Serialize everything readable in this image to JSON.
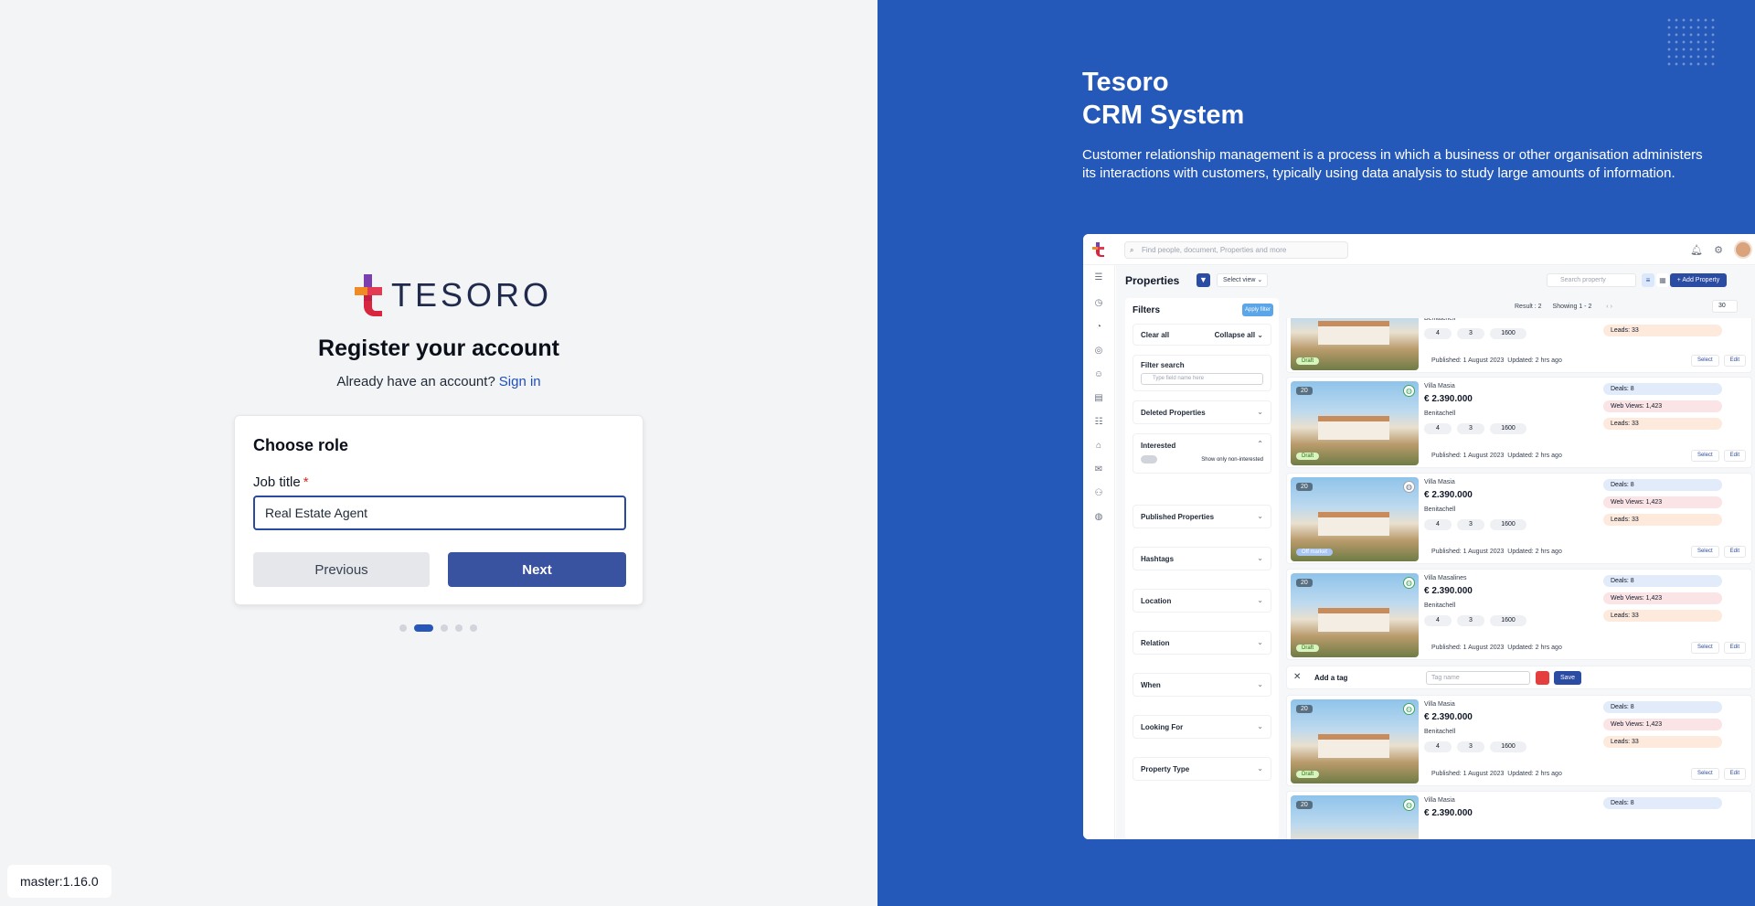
{
  "brand": {
    "name": "TESORO"
  },
  "register": {
    "title": "Register your account",
    "have_account": "Already have an account?",
    "sign_in": "Sign in"
  },
  "card": {
    "title": "Choose role",
    "job_title_label": "Job title",
    "required_mark": "*",
    "job_title_value": "Real Estate Agent",
    "previous_label": "Previous",
    "next_label": "Next"
  },
  "stepper": {
    "total": 5,
    "current": 2
  },
  "version": "master:1.16.0",
  "promo": {
    "title_line1": "Tesoro",
    "title_line2": "CRM System",
    "description": "Customer relationship management is a process in which a business or other organisation administers its interactions with customers, typically using data analysis to study large amounts of information."
  },
  "colors": {
    "primary": "#2559b9",
    "button": "#3a53a0",
    "link": "#1d4fbf"
  },
  "mock": {
    "search_placeholder": "Find people, document, Properties and more",
    "page_title": "Properties",
    "select_view": "Select view ⌄",
    "search_property": "Search property",
    "add_property": "+ Add Property",
    "filters_title": "Filters",
    "apply_filter": "Apply filter",
    "clear_all": "Clear all",
    "collapse_all": "Collapse all ⌄",
    "filter_search_label": "Filter search",
    "filter_search_placeholder": "Type field name here",
    "interested_toggle": "Show only non-interested",
    "filter_sections": [
      "Deleted Properties",
      "Interested",
      "Published Properties",
      "Hashtags",
      "Location",
      "Relation",
      "When",
      "Looking For",
      "Property  Type"
    ],
    "result": "Result : 2",
    "showing": "Showing 1 - 2",
    "per_page": "30",
    "add_tag": "Add a tag",
    "tag_placeholder": "Tag name",
    "save": "Save",
    "listings": [
      {
        "name": "Villa Masia",
        "price": "€ 2.390.000",
        "city": "Benitachell",
        "photos": "20",
        "status": "Draft",
        "beds": "4",
        "baths": "3",
        "area": "1600",
        "published": "Published: 1 August 2023",
        "updated": "Updated: 2 hrs ago",
        "deals": "Deals: 8",
        "views": "Web Views: 1,423",
        "leads": "Leads: 33"
      },
      {
        "name": "Villa Masia",
        "price": "€ 2.390.000",
        "city": "Benitachell",
        "photos": "20",
        "status": "Off market",
        "beds": "4",
        "baths": "3",
        "area": "1600",
        "published": "Published: 1 August 2023",
        "updated": "Updated: 2 hrs ago",
        "deals": "Deals: 8",
        "views": "Web Views: 1,423",
        "leads": "Leads: 33"
      },
      {
        "name": "Villa Masalines",
        "price": "€ 2.390.000",
        "city": "Benitachell",
        "photos": "20",
        "status": "Draft",
        "beds": "4",
        "baths": "3",
        "area": "1600",
        "published": "Published: 1 August 2023",
        "updated": "Updated: 2 hrs ago",
        "deals": "Deals: 8",
        "views": "Web Views: 1,423",
        "leads": "Leads: 33"
      },
      {
        "name": "Villa Masia",
        "price": "€ 2.390.000",
        "city": "Benitachell",
        "photos": "20",
        "status": "Draft",
        "beds": "4",
        "baths": "3",
        "area": "1600",
        "published": "Published: 1 August 2023",
        "updated": "Updated: 2 hrs ago",
        "deals": "Deals: 8",
        "views": "Web Views: 1,423",
        "leads": "Leads: 33"
      }
    ],
    "select_label": "Select",
    "edit_label": "Edit"
  }
}
